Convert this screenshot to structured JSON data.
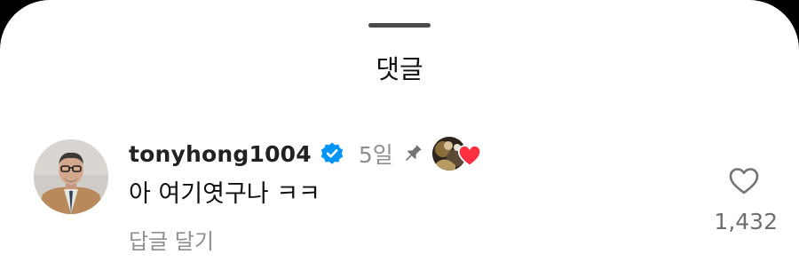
{
  "sheet": {
    "title": "댓글"
  },
  "comment": {
    "username": "tonyhong1004",
    "verified": true,
    "time_ago": "5일",
    "pinned": true,
    "liked_by_author": true,
    "text": "아 여기엿구나 ㅋㅋ",
    "reply_label": "답글 달기",
    "like_count": "1,432"
  },
  "icons": {
    "verified": "verified-badge-icon",
    "pin": "pin-icon",
    "like": "heart-outline-icon",
    "author_like": "heart-filled-icon"
  },
  "colors": {
    "verified_blue": "#0095f6",
    "heart_red": "#ff3040",
    "muted_text": "#8e8e8e"
  }
}
